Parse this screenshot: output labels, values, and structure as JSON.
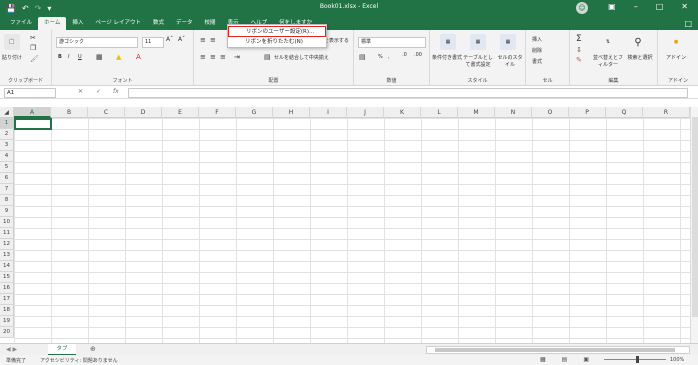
{
  "titlebar": {
    "save_icon": "save-icon",
    "undo_icon": "undo-icon",
    "redo_icon": "redo-icon",
    "customize_icon": "customize-qa-icon",
    "window_title": "Book01.xlsx  -  Excel",
    "user_initial": "☺",
    "btns": [
      "□",
      "–",
      "□",
      "✕"
    ]
  },
  "tabs": [
    "ファイル",
    "ホーム",
    "挿入",
    "ページ レイアウト",
    "数式",
    "データ",
    "校閲",
    "表示",
    "ヘルプ",
    "何をしますか"
  ],
  "active_tab": "ホーム",
  "ribbon": {
    "clipboard": {
      "label": "クリップボード",
      "paste": "貼り付け"
    },
    "font": {
      "label": "フォント",
      "font_name": "游ゴシック",
      "font_size": "11",
      "bold": "B",
      "italic": "I",
      "underline": "U"
    },
    "alignment": {
      "label": "配置",
      "merge": "セルを結合して中央揃え",
      "wrap": "折り返して全体を表示する"
    },
    "number": {
      "label": "数値",
      "format": "標準",
      "percent": "%",
      "comma": ","
    },
    "styles": {
      "label": "スタイル",
      "cond": "条件付き書式",
      "table": "テーブルとして書式設定",
      "cell": "セルのスタイル"
    },
    "cells": {
      "label": "セル",
      "insert": "挿入",
      "delete": "削除",
      "format": "書式"
    },
    "editing": {
      "label": "編集",
      "sort": "並べ替えとフィルター",
      "find": "検索と選択"
    },
    "addins": {
      "label": "アドイン",
      "addin": "アドイン"
    }
  },
  "context_menu": {
    "items": [
      "リボンのユーザー設定(R)...",
      "リボンを折りたたむ(N)"
    ],
    "highlighted_index": 0
  },
  "formula_bar": {
    "name_box": "A1",
    "cancel": "✕",
    "enter": "✓",
    "fx": "fx",
    "value": ""
  },
  "grid": {
    "columns": [
      "A",
      "B",
      "C",
      "D",
      "E",
      "F",
      "G",
      "H",
      "I",
      "J",
      "K",
      "L",
      "M",
      "N",
      "O",
      "P",
      "Q",
      "R"
    ],
    "rows": [
      "1",
      "2",
      "3",
      "4",
      "5",
      "6",
      "7",
      "8",
      "9",
      "10",
      "11",
      "12",
      "13",
      "14",
      "15",
      "16",
      "17",
      "18",
      "19",
      "20"
    ],
    "active_cell": "A1"
  },
  "sheets": {
    "names": [
      "タブ"
    ],
    "active": "タブ",
    "add": "⊕"
  },
  "status": {
    "ready": "準備完了",
    "accessibility": "アクセシビリティ: 問題ありません",
    "zoom": "100%"
  },
  "colors": {
    "accent": "#217346",
    "highlight": "#e02424"
  }
}
